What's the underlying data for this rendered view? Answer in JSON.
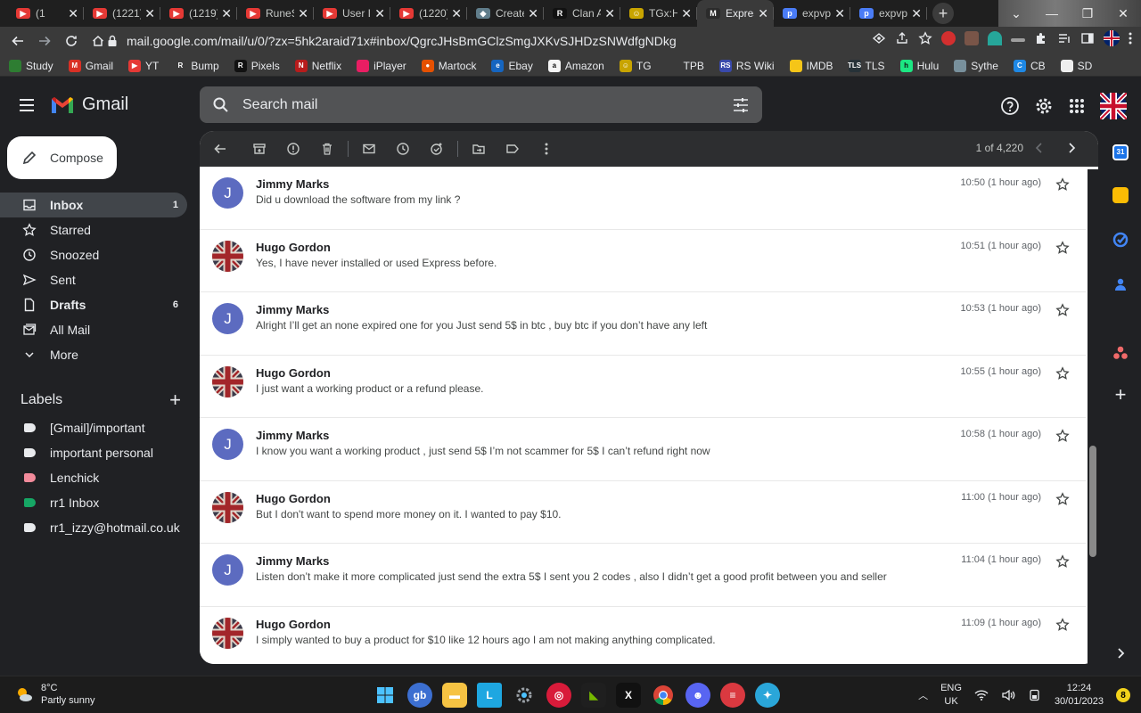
{
  "browser": {
    "tabs": [
      {
        "label": "(1",
        "fav": "#e53935",
        "glyph": "▶"
      },
      {
        "label": "(1221)",
        "fav": "#e53935",
        "glyph": "▶"
      },
      {
        "label": "(1219)",
        "fav": "#e53935",
        "glyph": "▶"
      },
      {
        "label": "RuneS",
        "fav": "#e53935",
        "glyph": "▶"
      },
      {
        "label": "User I",
        "fav": "#e53935",
        "glyph": "▶"
      },
      {
        "label": "(1220)",
        "fav": "#e53935",
        "glyph": "▶"
      },
      {
        "label": "Create",
        "fav": "#607d8b",
        "glyph": "◆"
      },
      {
        "label": "Clan A",
        "fav": "#111111",
        "glyph": "R"
      },
      {
        "label": "TGx:H",
        "fav": "#c8a400",
        "glyph": "☺"
      },
      {
        "label": "Expres",
        "fav": "#2b2b2b",
        "glyph": "M",
        "active": true
      },
      {
        "label": "expvp",
        "fav": "#4a7cf6",
        "glyph": "p"
      },
      {
        "label": "expvp",
        "fav": "#4a7cf6",
        "glyph": "p"
      }
    ],
    "url": "mail.google.com/mail/u/0/?zx=5hk2araid71x#inbox/QgrcJHsBmGClzSmgJXKvSJHDzSNWdfgNDkg",
    "bookmarks": [
      {
        "label": "Study",
        "color": "#2e7d32",
        "glyph": ""
      },
      {
        "label": "Gmail",
        "color": "#d93025",
        "glyph": "M"
      },
      {
        "label": "YT",
        "color": "#e53935",
        "glyph": "▶"
      },
      {
        "label": "Bump",
        "color": "#3a3a3a",
        "glyph": "R"
      },
      {
        "label": "Pixels",
        "color": "#111111",
        "glyph": "R"
      },
      {
        "label": "Netflix",
        "color": "#b71c1c",
        "glyph": "N"
      },
      {
        "label": "iPlayer",
        "color": "#e91e63",
        "glyph": ""
      },
      {
        "label": "Martock",
        "color": "#e65100",
        "glyph": "●"
      },
      {
        "label": "Ebay",
        "color": "#1565c0",
        "glyph": "e"
      },
      {
        "label": "Amazon",
        "color": "#f5f5f5",
        "glyph": "a"
      },
      {
        "label": "TG",
        "color": "#c8a400",
        "glyph": "☺"
      },
      {
        "label": "TPB",
        "color": "#3a3a3a",
        "glyph": ""
      },
      {
        "label": "RS Wiki",
        "color": "#3949ab",
        "glyph": "RS"
      },
      {
        "label": "IMDB",
        "color": "#f5c518",
        "glyph": ""
      },
      {
        "label": "TLS",
        "color": "#263238",
        "glyph": "TLS"
      },
      {
        "label": "Hulu",
        "color": "#1ce783",
        "glyph": "h"
      },
      {
        "label": "Sythe",
        "color": "#78909c",
        "glyph": ""
      },
      {
        "label": "CB",
        "color": "#1e88e5",
        "glyph": "C"
      },
      {
        "label": "SD",
        "color": "#eeeeee",
        "glyph": ""
      }
    ]
  },
  "header": {
    "app_name": "Gmail",
    "search_placeholder": "Search mail"
  },
  "compose_label": "Compose",
  "nav": [
    {
      "label": "Inbox",
      "icon": "inbox-icon",
      "count": "1",
      "active": true
    },
    {
      "label": "Starred",
      "icon": "star-icon",
      "count": ""
    },
    {
      "label": "Snoozed",
      "icon": "clock-icon",
      "count": ""
    },
    {
      "label": "Sent",
      "icon": "send-icon",
      "count": ""
    },
    {
      "label": "Drafts",
      "icon": "draft-icon",
      "count": "6",
      "bold": true
    },
    {
      "label": "All Mail",
      "icon": "all-mail-icon",
      "count": ""
    },
    {
      "label": "More",
      "icon": "chevron-down-icon",
      "count": ""
    }
  ],
  "labels_title": "Labels",
  "labels": [
    {
      "label": "[Gmail]/important",
      "color": "#e8eaed"
    },
    {
      "label": "important personal",
      "color": "#e8eaed"
    },
    {
      "label": "Lenchick",
      "color": "#f28b9b"
    },
    {
      "label": "rr1 Inbox",
      "color": "#16a765"
    },
    {
      "label": "rr1_izzy@hotmail.co.uk",
      "color": "#e8eaed"
    }
  ],
  "pager": {
    "text": "1 of 4,220"
  },
  "messages": [
    {
      "sender": "Jimmy Marks",
      "avatar": "J",
      "snippet": "Did u download the software from my link ?",
      "time": "10:50 (1 hour ago)"
    },
    {
      "sender": "Hugo Gordon",
      "avatar": "flag",
      "snippet": "Yes, I have never installed or used Express before.",
      "time": "10:51 (1 hour ago)"
    },
    {
      "sender": "Jimmy Marks",
      "avatar": "J",
      "snippet": "Alright I’ll get an none expired one for you Just send 5$ in btc , buy btc if you don’t have any left",
      "time": "10:53 (1 hour ago)"
    },
    {
      "sender": "Hugo Gordon",
      "avatar": "flag",
      "snippet": "I just want a working product or a refund please.",
      "time": "10:55 (1 hour ago)"
    },
    {
      "sender": "Jimmy Marks",
      "avatar": "J",
      "snippet": "I know you want a working product , just send 5$ I’m not scammer for 5$ I can’t refund right now",
      "time": "10:58 (1 hour ago)"
    },
    {
      "sender": "Hugo Gordon",
      "avatar": "flag",
      "snippet": "But I don't want to spend more money on it. I wanted to pay $10.",
      "time": "11:00 (1 hour ago)"
    },
    {
      "sender": "Jimmy Marks",
      "avatar": "J",
      "snippet": "Listen don’t make it more complicated just send the extra 5$ I sent you 2 codes , also I didn’t get a good profit between you and seller",
      "time": "11:04 (1 hour ago)"
    },
    {
      "sender": "Hugo Gordon",
      "avatar": "flag",
      "snippet": "I simply wanted to buy a product for $10 like 12 hours ago I am not making anything complicated.",
      "time": "11:09 (1 hour ago)"
    }
  ],
  "taskbar": {
    "temp": "8°C",
    "condition": "Partly sunny",
    "lang_top": "ENG",
    "lang_bottom": "UK",
    "time": "12:24",
    "date": "30/01/2023",
    "notif_count": "8"
  }
}
